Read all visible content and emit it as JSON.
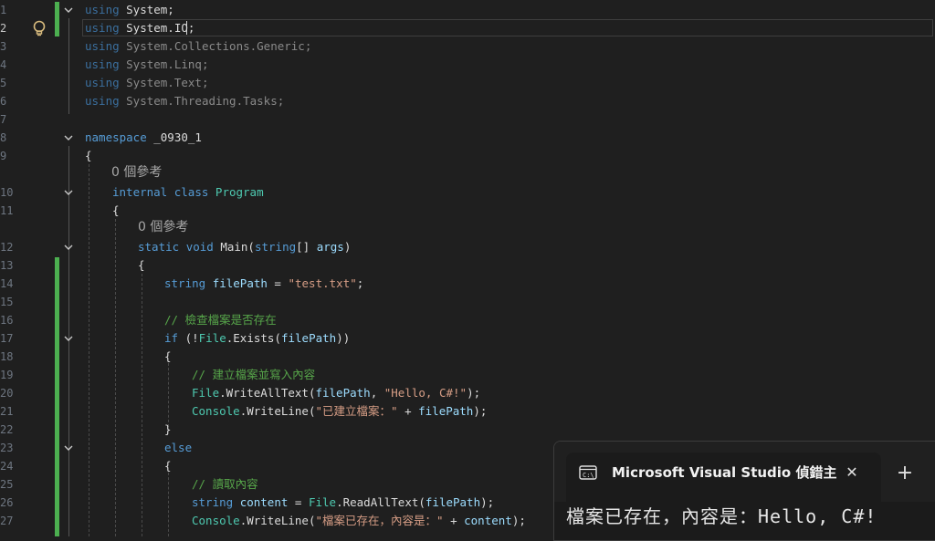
{
  "editor": {
    "lines": [
      {
        "n": "1",
        "parts": [
          [
            "kwdim",
            "using"
          ],
          [
            "",
            "System;"
          ]
        ]
      },
      {
        "n": "2",
        "parts": [
          [
            "kwdim",
            "using"
          ],
          [
            "",
            "System.IO;"
          ]
        ]
      },
      {
        "n": "3",
        "parts": [
          [
            "kwdim",
            "using"
          ],
          [
            "dim",
            "System.Collections.Generic;"
          ]
        ]
      },
      {
        "n": "4",
        "parts": [
          [
            "kwdim",
            "using"
          ],
          [
            "dim",
            "System.Linq;"
          ]
        ]
      },
      {
        "n": "5",
        "parts": [
          [
            "kwdim",
            "using"
          ],
          [
            "dim",
            "System.Text;"
          ]
        ]
      },
      {
        "n": "6",
        "parts": [
          [
            "kwdim",
            "using"
          ],
          [
            "dim",
            "System.Threading.Tasks;"
          ]
        ]
      },
      {
        "n": "7",
        "parts": []
      },
      {
        "n": "8",
        "parts": [
          [
            "kw",
            "namespace"
          ],
          [
            "",
            " _0930_1"
          ]
        ]
      },
      {
        "n": "9",
        "parts": [
          [
            "",
            "{"
          ]
        ]
      },
      {
        "n": "10",
        "parts": [
          [
            "kw",
            "internal"
          ],
          [
            "",
            " "
          ],
          [
            "kw",
            "class"
          ],
          [
            "",
            " "
          ],
          [
            "ty",
            "Program"
          ]
        ]
      },
      {
        "n": "11",
        "parts": [
          [
            "",
            "{"
          ]
        ]
      },
      {
        "n": "12",
        "parts": [
          [
            "kw",
            "static"
          ],
          [
            "",
            " "
          ],
          [
            "kw",
            "void"
          ],
          [
            "",
            " "
          ],
          [
            "",
            "Main("
          ],
          [
            "kw",
            "string"
          ],
          [
            "",
            "[] "
          ],
          [
            "pm",
            "args"
          ],
          [
            "",
            ")"
          ]
        ]
      },
      {
        "n": "13",
        "parts": [
          [
            "",
            "{"
          ]
        ]
      },
      {
        "n": "14",
        "parts": [
          [
            "kw",
            "string"
          ],
          [
            "",
            " "
          ],
          [
            "pm",
            "filePath"
          ],
          [
            "",
            " = "
          ],
          [
            "st",
            "\"test.txt\""
          ],
          [
            "",
            ";"
          ]
        ]
      },
      {
        "n": "15",
        "parts": []
      },
      {
        "n": "16",
        "parts": [
          [
            "cm",
            "// 檢查檔案是否存在"
          ]
        ]
      },
      {
        "n": "17",
        "parts": [
          [
            "kw",
            "if"
          ],
          [
            "",
            " (!"
          ],
          [
            "ty",
            "File"
          ],
          [
            "",
            ".Exists("
          ],
          [
            "pm",
            "filePath"
          ],
          [
            "",
            "))"
          ]
        ]
      },
      {
        "n": "18",
        "parts": [
          [
            "",
            "{"
          ]
        ]
      },
      {
        "n": "19",
        "parts": [
          [
            "cm",
            "// 建立檔案並寫入內容"
          ]
        ]
      },
      {
        "n": "20",
        "parts": [
          [
            "ty",
            "File"
          ],
          [
            "",
            ".WriteAllText("
          ],
          [
            "pm",
            "filePath"
          ],
          [
            "",
            ", "
          ],
          [
            "st",
            "\"Hello, C#!\""
          ],
          [
            "",
            ");"
          ]
        ]
      },
      {
        "n": "21",
        "parts": [
          [
            "ty",
            "Console"
          ],
          [
            "",
            ".WriteLine("
          ],
          [
            "st",
            "\"已建立檔案：\""
          ],
          [
            "",
            " + "
          ],
          [
            "pm",
            "filePath"
          ],
          [
            "",
            ");"
          ]
        ]
      },
      {
        "n": "22",
        "parts": [
          [
            "",
            "}"
          ]
        ]
      },
      {
        "n": "23",
        "parts": [
          [
            "kw",
            "else"
          ]
        ]
      },
      {
        "n": "24",
        "parts": [
          [
            "",
            "{"
          ]
        ]
      },
      {
        "n": "25",
        "parts": [
          [
            "cm",
            "// 讀取內容"
          ]
        ]
      },
      {
        "n": "26",
        "parts": [
          [
            "kw",
            "string"
          ],
          [
            "",
            " "
          ],
          [
            "pm",
            "content"
          ],
          [
            "",
            " = "
          ],
          [
            "ty",
            "File"
          ],
          [
            "",
            ".ReadAllText("
          ],
          [
            "pm",
            "filePath"
          ],
          [
            "",
            ");"
          ]
        ]
      },
      {
        "n": "27",
        "parts": [
          [
            "ty",
            "Console"
          ],
          [
            "",
            ".WriteLine("
          ],
          [
            "st",
            "\"檔案已存在，內容是：\""
          ],
          [
            "",
            " + "
          ],
          [
            "pm",
            "content"
          ],
          [
            "",
            ");"
          ]
        ]
      }
    ],
    "references": [
      "0 個參考",
      "0 個參考"
    ]
  },
  "terminal": {
    "tab_title": "Microsoft Visual Studio 偵錯主",
    "close_glyph": "✕",
    "new_tab_glyph": "+",
    "output": "檔案已存在，內容是：Hello, C#!"
  }
}
